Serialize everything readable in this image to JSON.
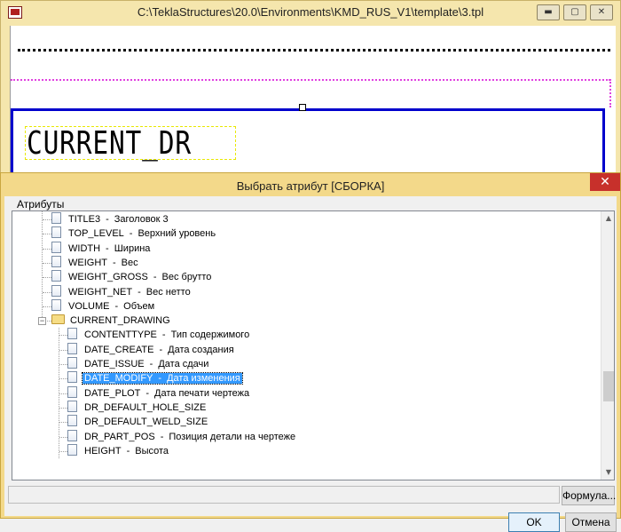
{
  "back_window": {
    "title": "C:\\TeklaStructures\\20.0\\Environments\\KMD_RUS_V1\\template\\3.tpl",
    "canvas_text": "CURRENT_DR",
    "controls": {
      "minimize": "▬",
      "maximize": "▢",
      "close": "✕"
    }
  },
  "dialog": {
    "title": "Выбрать атрибут [СБОРКА]",
    "close": "✕",
    "group_label": "Атрибуты",
    "tree_items": [
      {
        "name": "TITLE3",
        "desc": "Заголовок 3",
        "level": 1
      },
      {
        "name": "TOP_LEVEL",
        "desc": "Верхний уровень",
        "level": 1
      },
      {
        "name": "WIDTH",
        "desc": "Ширина",
        "level": 1
      },
      {
        "name": "WEIGHT",
        "desc": "Вес",
        "level": 1
      },
      {
        "name": "WEIGHT_GROSS",
        "desc": "Вес брутто",
        "level": 1
      },
      {
        "name": "WEIGHT_NET",
        "desc": "Вес нетто",
        "level": 1
      },
      {
        "name": "VOLUME",
        "desc": "Объем",
        "level": 1
      },
      {
        "name": "CURRENT_DRAWING",
        "desc": "",
        "level": 1,
        "folder": true
      },
      {
        "name": "CONTENTTYPE",
        "desc": "Тип содержимого",
        "level": 2
      },
      {
        "name": "DATE_CREATE",
        "desc": "Дата создания",
        "level": 2
      },
      {
        "name": "DATE_ISSUE",
        "desc": "Дата сдачи",
        "level": 2
      },
      {
        "name": "DATE_MODIFY",
        "desc": "Дата изменения",
        "level": 2,
        "selected": true
      },
      {
        "name": "DATE_PLOT",
        "desc": "Дата печати чертежа",
        "level": 2
      },
      {
        "name": "DR_DEFAULT_HOLE_SIZE",
        "desc": "",
        "level": 2
      },
      {
        "name": "DR_DEFAULT_WELD_SIZE",
        "desc": "",
        "level": 2
      },
      {
        "name": "DR_PART_POS",
        "desc": "Позиция детали на чертеже",
        "level": 2
      },
      {
        "name": "HEIGHT",
        "desc": "Высота",
        "level": 2
      }
    ],
    "separator": "-",
    "formula_value": "",
    "buttons": {
      "formula": "Формула...",
      "ok": "OK",
      "cancel": "Отмена"
    }
  },
  "colors": {
    "selection": "#3399ff",
    "frame_blue": "#0000cc",
    "title_bar": "#f3d98a"
  }
}
